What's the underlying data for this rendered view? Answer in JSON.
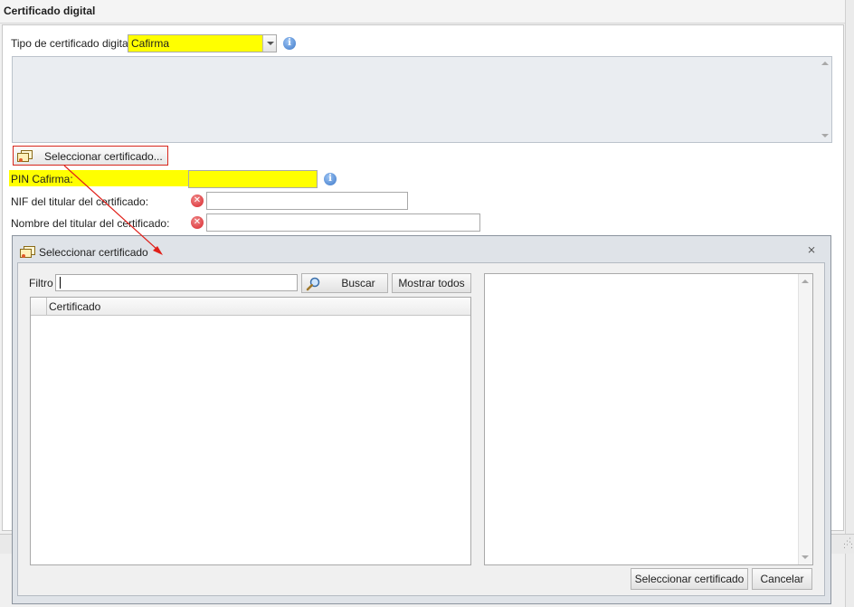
{
  "header": {
    "title": "Certificado digital"
  },
  "form": {
    "cert_type_label": "Tipo de certificado digital:",
    "cert_type_value": "Cafirma",
    "select_button_label": "Seleccionar certificado...",
    "pin_label": "PIN Cafirma:",
    "pin_value": "",
    "nif_label": "NIF del titular del certificado:",
    "nif_value": "",
    "name_label": "Nombre del titular del certificado:",
    "name_value": ""
  },
  "dialog": {
    "title": "Seleccionar certificado",
    "close_glyph": "⨯",
    "filter_label": "Filtro",
    "filter_value": "",
    "search_button": "Buscar",
    "show_all_button": "Mostrar todos",
    "grid_column": "Certificado",
    "select_button": "Seleccionar certificado",
    "cancel_button": "Cancelar"
  },
  "icons": {
    "info": "info-icon",
    "error": "error-icon",
    "certificate": "certificate-icon",
    "search": "magnifier-icon"
  },
  "colors": {
    "highlight": "#ffff00",
    "callout": "#e0201a",
    "error": "#d9262c",
    "info": "#3d78c8"
  }
}
